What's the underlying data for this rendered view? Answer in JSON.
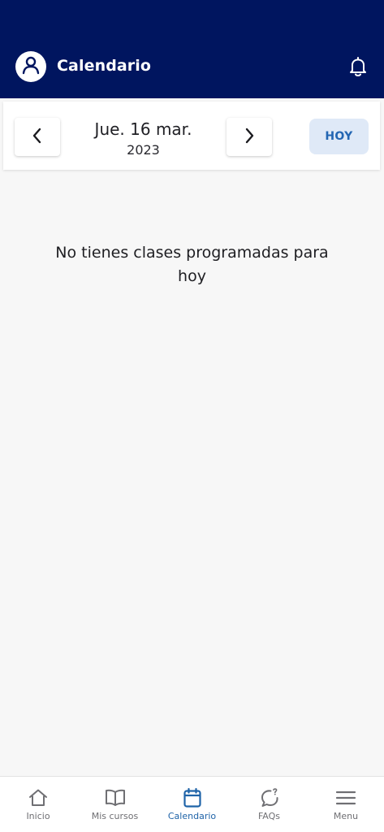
{
  "header": {
    "title": "Calendario",
    "avatar_icon": "user-icon",
    "notification_icon": "bell-icon",
    "background": "#00155f"
  },
  "date_nav": {
    "date": "Jue. 16 mar.",
    "year": "2023",
    "prev_icon": "chevron-left-icon",
    "next_icon": "chevron-right-icon",
    "today_label": "HOY"
  },
  "main": {
    "empty_message": "No tienes clases programadas para hoy"
  },
  "tabbar": {
    "active_color": "#1f63a8",
    "tabs": [
      {
        "label": "Inicio",
        "icon": "home-icon"
      },
      {
        "label": "Mis cursos",
        "icon": "book-icon"
      },
      {
        "label": "Calendario",
        "icon": "calendar-icon",
        "active": true
      },
      {
        "label": "FAQs",
        "icon": "faq-bubble-icon"
      },
      {
        "label": "Menu",
        "icon": "menu-icon"
      }
    ]
  }
}
